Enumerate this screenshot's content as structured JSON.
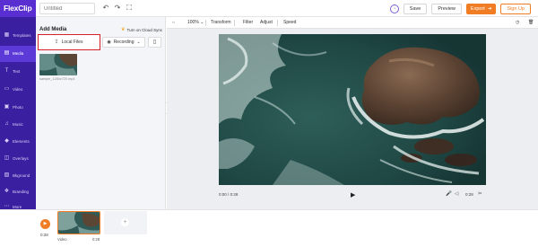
{
  "app": {
    "logo": "FlexClip"
  },
  "header": {
    "title_placeholder": "Untitled",
    "undo_icon": "undo-icon",
    "redo_icon": "redo-icon",
    "fullscreen_icon": "expand-icon",
    "chat_icon": "chat-icon",
    "save_label": "Save",
    "preview_label": "Preview",
    "export_label": "Export",
    "signup_label": "Sign Up"
  },
  "sidebar": {
    "items": [
      {
        "label": "Templates",
        "icon": "templates-icon"
      },
      {
        "label": "Media",
        "icon": "media-icon",
        "active": true
      },
      {
        "label": "Text",
        "icon": "text-icon"
      },
      {
        "label": "Video",
        "icon": "video-icon"
      },
      {
        "label": "Photo",
        "icon": "photo-icon"
      },
      {
        "label": "Music",
        "icon": "music-icon"
      },
      {
        "label": "Elements",
        "icon": "elements-icon"
      },
      {
        "label": "Overlays",
        "icon": "overlays-icon"
      },
      {
        "label": "Bkground",
        "icon": "background-icon"
      },
      {
        "label": "Branding",
        "icon": "branding-icon"
      },
      {
        "label": "More",
        "icon": "more-icon"
      }
    ]
  },
  "media_panel": {
    "title": "Add Media",
    "cloud_sync": "Turn on Cloud Sync",
    "local_files": "Local Files",
    "recording": "Recording",
    "thumbnail_name": "sample_1280x720.mp4"
  },
  "edit_toolbar": {
    "zoom": "100%",
    "items": [
      "Transform",
      "Filter",
      "Adjust",
      "Speed"
    ]
  },
  "player": {
    "current_time": "0:00",
    "total_time": "0:28",
    "duration_right": "0:28"
  },
  "timeline": {
    "play_time": "0:28",
    "clip_label": "Video",
    "clip_duration": "0:28"
  },
  "colors": {
    "brand_purple": "#3a1fa0",
    "logo_purple": "#5a2fd1",
    "accent_orange": "#f07d24",
    "highlight_red": "#d9202b"
  }
}
